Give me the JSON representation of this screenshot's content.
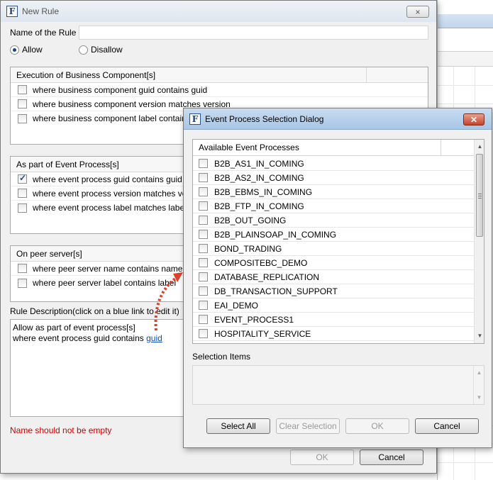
{
  "new_rule": {
    "title": "New Rule",
    "close_icon": "×",
    "name_label": "Name of the Rule",
    "name_value": "",
    "allow_label": "Allow",
    "disallow_label": "Disallow",
    "allow_selected": true,
    "business_component": {
      "header": "Execution of Business Component[s]",
      "items": [
        {
          "label": "where business component guid contains guid",
          "checked": false
        },
        {
          "label": "where business component version matches version",
          "checked": false
        },
        {
          "label": "where business component label contains",
          "checked": false
        }
      ]
    },
    "event_process": {
      "header": "As part of Event Process[s]",
      "items": [
        {
          "label": "where event process guid contains guid",
          "checked": true
        },
        {
          "label": "where event process version matches ver",
          "checked": false
        },
        {
          "label": "where event process label matches label",
          "checked": false
        }
      ]
    },
    "peer_server": {
      "header": "On peer server[s]",
      "items": [
        {
          "label": "where peer server name contains name",
          "checked": false
        },
        {
          "label": "where peer server label contains label",
          "checked": false
        }
      ]
    },
    "description_label": "Rule Description(click on a blue link to edit it)",
    "description_line1": "Allow as part of event process[s]",
    "description_line2_prefix": "where event process guid contains",
    "description_link": "guid",
    "error": "Name should not be empty",
    "ok_label": "OK",
    "cancel_label": "Cancel"
  },
  "event_dialog": {
    "title": "Event Process Selection Dialog",
    "close_icon": "✕",
    "list_header": "Available Event Processes",
    "items": [
      "B2B_AS1_IN_COMING",
      "B2B_AS2_IN_COMING",
      "B2B_EBMS_IN_COMING",
      "B2B_FTP_IN_COMING",
      "B2B_OUT_GOING",
      "B2B_PLAINSOAP_IN_COMING",
      "BOND_TRADING",
      "COMPOSITEBC_DEMO",
      "DATABASE_REPLICATION",
      "DB_TRANSACTION_SUPPORT",
      "EAI_DEMO",
      "EVENT_PROCESS1",
      "HOSPITALITY_SERVICE"
    ],
    "selection_label": "Selection Items",
    "select_all_label": "Select All",
    "clear_selection_label": "Clear Selection",
    "ok_label": "OK",
    "cancel_label": "Cancel"
  },
  "colors": {
    "error": "#cc0000",
    "link": "#0a4fb6",
    "arrow": "#e0402a"
  },
  "icons": {
    "app_icon": "F"
  }
}
